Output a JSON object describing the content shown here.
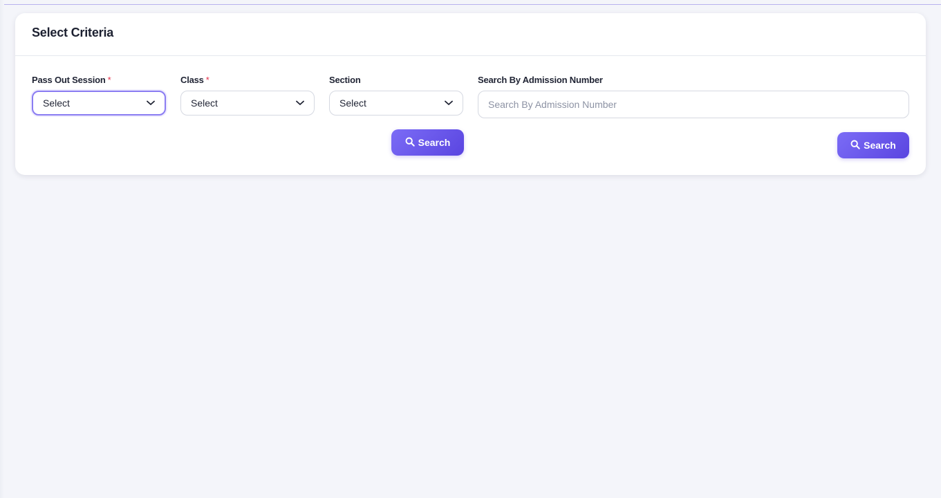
{
  "card": {
    "title": "Select Criteria"
  },
  "criteria": {
    "pass_out_session": {
      "label": "Pass Out Session",
      "required_mark": "*",
      "value": "Select"
    },
    "class": {
      "label": "Class",
      "required_mark": "*",
      "value": "Select"
    },
    "section": {
      "label": "Section",
      "value": "Select"
    },
    "search_button": {
      "label": "Search",
      "icon": "search-icon"
    }
  },
  "admission_search": {
    "label": "Search By Admission Number",
    "placeholder": "Search By Admission Number",
    "value": "",
    "search_button": {
      "label": "Search",
      "icon": "search-icon"
    }
  },
  "colors": {
    "accent": "#6a57ec",
    "background": "#f4f5fa",
    "required": "#e4304a"
  }
}
